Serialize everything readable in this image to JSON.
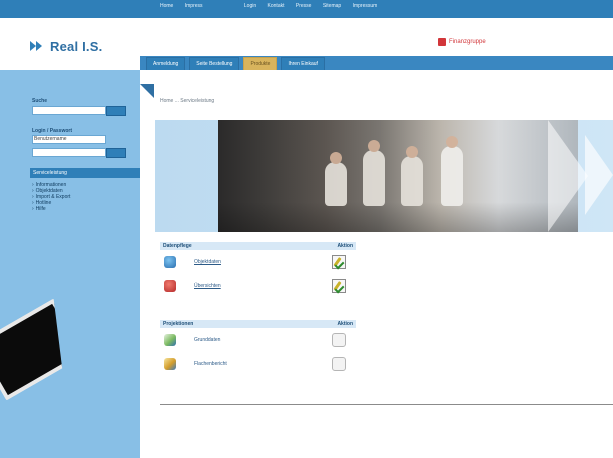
{
  "topbar": {
    "left_links": [
      "Home",
      "Impress"
    ],
    "right_links": [
      "Login",
      "Kontakt",
      "Presse",
      "Sitemap",
      "Impressum"
    ]
  },
  "brand": {
    "name": "Real I.S.",
    "group_label": "Finanzgruppe"
  },
  "tabs": [
    {
      "label": "Anmeldung"
    },
    {
      "label": "Seite Bestellung"
    },
    {
      "label": "Produkte",
      "active": true
    },
    {
      "label": "Ihren Einkauf"
    }
  ],
  "sidebar": {
    "search": {
      "label": "Suche",
      "value": ""
    },
    "login": {
      "label": "Login / Passwort",
      "user_value": "Benutzername",
      "pass_value": ""
    },
    "section_title": "Serviceleistung",
    "menu": [
      "Informationen",
      "Objektdaten",
      "Import & Export",
      "Hotline",
      "Hilfe"
    ]
  },
  "breadcrumb": "Home ... Serviceleistung",
  "panels": {
    "datenpflege": {
      "title": "Datenpflege",
      "action_header": "Aktion",
      "items": [
        {
          "label": "Objektdaten"
        },
        {
          "label": "Übersichten"
        }
      ]
    },
    "projektionen": {
      "title": "Projektionen",
      "action_header": "Aktion",
      "items": [
        {
          "label": "Grunddaten"
        },
        {
          "label": "Flachenbericht"
        }
      ]
    }
  },
  "colors": {
    "brand_blue": "#2f7fb8",
    "sidebar_blue": "#88bfe6",
    "tab_active": "#d8b45d",
    "finanz_red": "#d2363a"
  },
  "icons": {
    "search_button": "search-button-icon",
    "login_button": "login-button-icon",
    "edit": "edit-pencil-icon",
    "placeholder": "empty-action-icon"
  }
}
